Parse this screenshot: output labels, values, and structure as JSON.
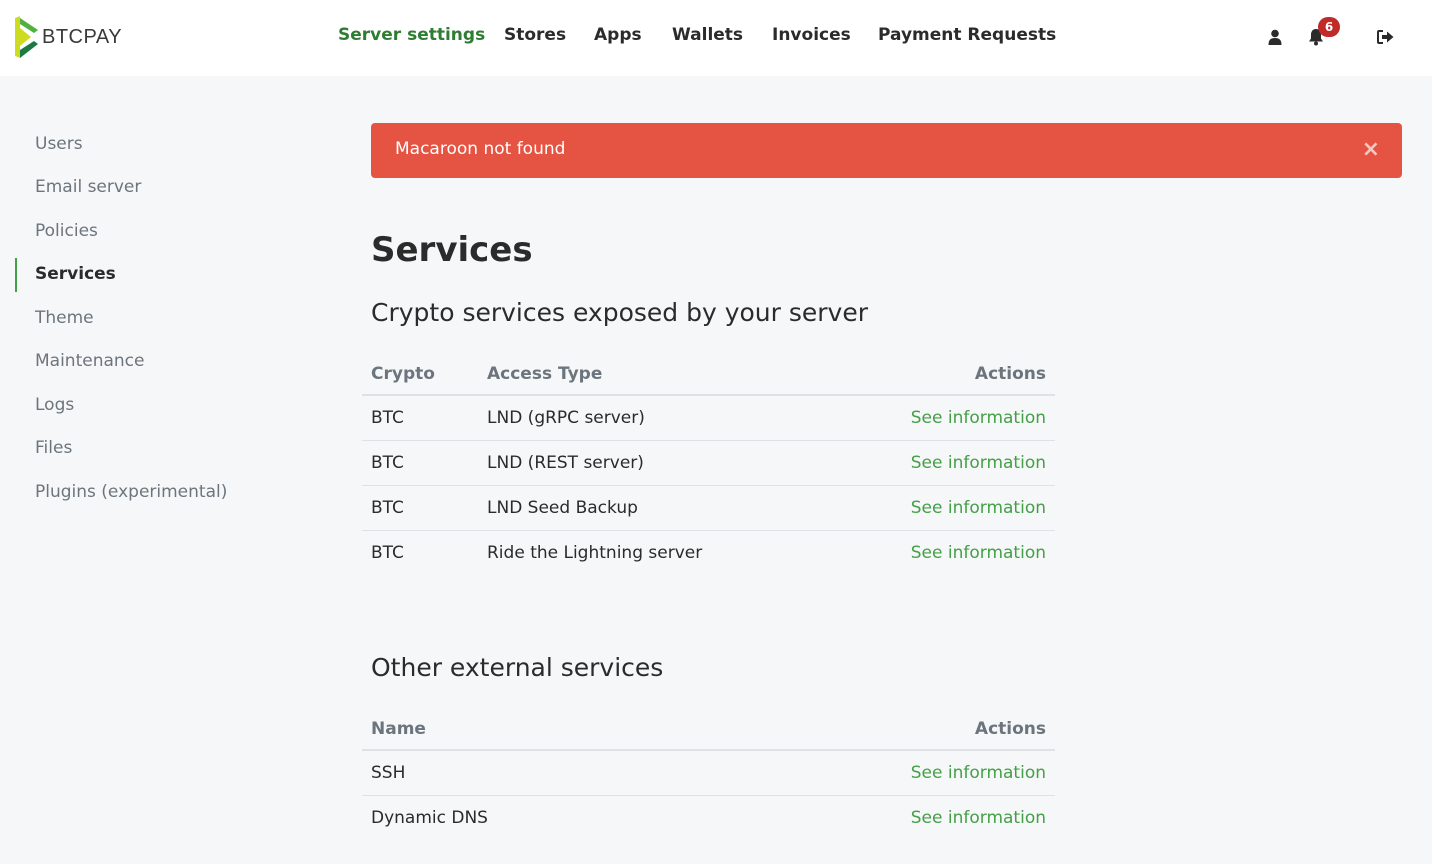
{
  "brand": {
    "name": "BTCPAY",
    "green": "#44a047",
    "lime": "#cedc21",
    "dark_green": "#1e7a44"
  },
  "nav": {
    "items": [
      {
        "label": "Server settings",
        "active": true
      },
      {
        "label": "Stores"
      },
      {
        "label": "Apps"
      },
      {
        "label": "Wallets"
      },
      {
        "label": "Invoices"
      },
      {
        "label": "Payment Requests"
      }
    ],
    "icons": {
      "account": "user-icon",
      "notifications": "bell-icon",
      "logout": "logout-icon"
    },
    "notification_count": "6"
  },
  "sidebar": {
    "items": [
      {
        "label": "Users"
      },
      {
        "label": "Email server"
      },
      {
        "label": "Policies"
      },
      {
        "label": "Services",
        "active": true
      },
      {
        "label": "Theme"
      },
      {
        "label": "Maintenance"
      },
      {
        "label": "Logs"
      },
      {
        "label": "Files"
      },
      {
        "label": "Plugins (experimental)"
      }
    ]
  },
  "alert": {
    "message": "Macaroon not found",
    "close": "×",
    "color": "#e55342"
  },
  "page": {
    "title": "Services",
    "crypto_section": {
      "heading": "Crypto services exposed by your server",
      "columns": [
        "Crypto",
        "Access Type",
        "Actions"
      ],
      "rows": [
        {
          "crypto": "BTC",
          "access_type": "LND (gRPC server)",
          "action": "See information"
        },
        {
          "crypto": "BTC",
          "access_type": "LND (REST server)",
          "action": "See information"
        },
        {
          "crypto": "BTC",
          "access_type": "LND Seed Backup",
          "action": "See information"
        },
        {
          "crypto": "BTC",
          "access_type": "Ride the Lightning server",
          "action": "See information"
        }
      ]
    },
    "external_section": {
      "heading": "Other external services",
      "columns": [
        "Name",
        "Actions"
      ],
      "rows": [
        {
          "name": "SSH",
          "action": "See information"
        },
        {
          "name": "Dynamic DNS",
          "action": "See information"
        }
      ]
    }
  }
}
